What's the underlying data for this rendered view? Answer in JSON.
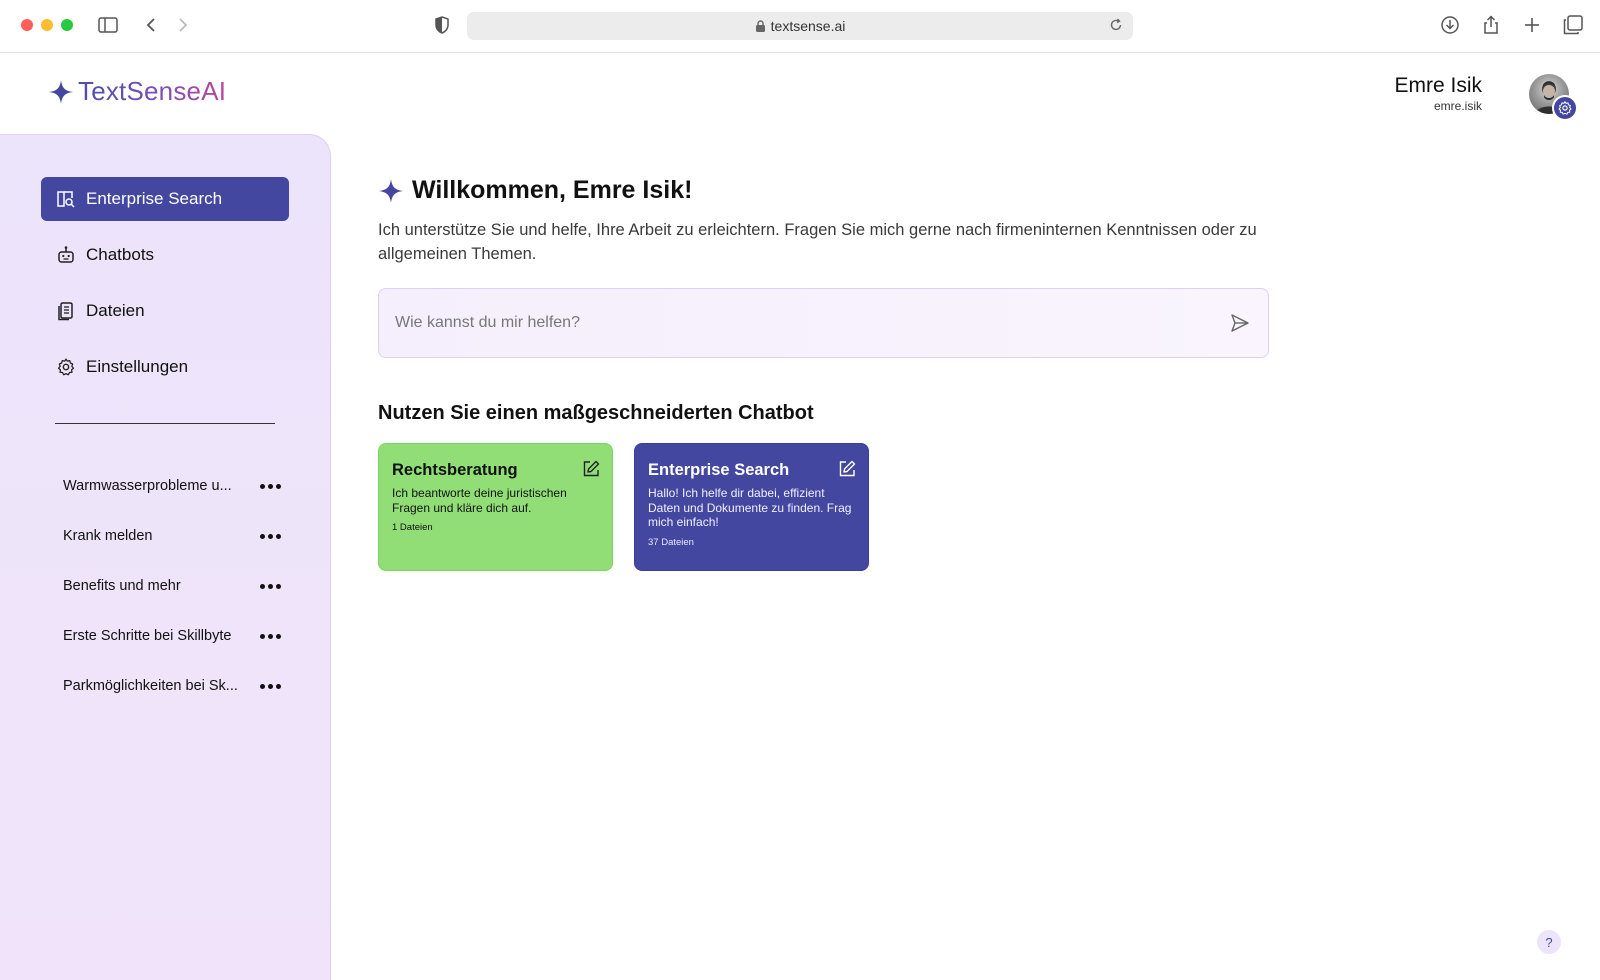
{
  "browser": {
    "url": "textsense.ai",
    "icons": [
      "sidebar-toggle-icon",
      "back-icon",
      "forward-icon",
      "shield-icon",
      "lock-icon",
      "reload-icon",
      "download-icon",
      "share-icon",
      "new-tab-icon",
      "tabs-overview-icon"
    ]
  },
  "brand": {
    "name": "TextSenseAI",
    "accent": "#4347a0",
    "gradient": [
      "#4b4fa8",
      "#c0459b"
    ]
  },
  "user": {
    "name": "Emre Isik",
    "handle": "emre.isik"
  },
  "sidebar": {
    "nav": [
      {
        "label": "Enterprise Search",
        "icon": "book-search-icon",
        "active": true
      },
      {
        "label": "Chatbots",
        "icon": "robot-icon",
        "active": false
      },
      {
        "label": "Dateien",
        "icon": "files-icon",
        "active": false
      },
      {
        "label": "Einstellungen",
        "icon": "gear-icon",
        "active": false
      }
    ],
    "chats": [
      {
        "label": "Warmwasserprobleme u..."
      },
      {
        "label": "Krank melden"
      },
      {
        "label": "Benefits und mehr"
      },
      {
        "label": "Erste Schritte bei Skillbyte"
      },
      {
        "label": "Parkmöglichkeiten bei Sk..."
      }
    ]
  },
  "main": {
    "welcome": "Willkommen, Emre Isik!",
    "intro": "Ich unterstütze Sie und helfe, Ihre Arbeit zu erleichtern. Fragen Sie mich gerne nach firmeninternen Kenntnissen oder zu allgemeinen Themen.",
    "prompt_placeholder": "Wie kannst du mir helfen?",
    "section_title": "Nutzen Sie einen maßgeschneiderten Chatbot",
    "cards": [
      {
        "title": "Rechtsberatung",
        "description": "Ich beantworte deine juristischen Fragen und kläre dich auf.",
        "meta": "1 Dateien",
        "color": "#91de77"
      },
      {
        "title": "Enterprise Search",
        "description": "Hallo! Ich helfe dir dabei, effizient Daten und Dokumente zu finden. Frag mich einfach!",
        "meta": "37 Dateien",
        "color": "#4347a0"
      }
    ]
  },
  "help": {
    "label": "?"
  }
}
